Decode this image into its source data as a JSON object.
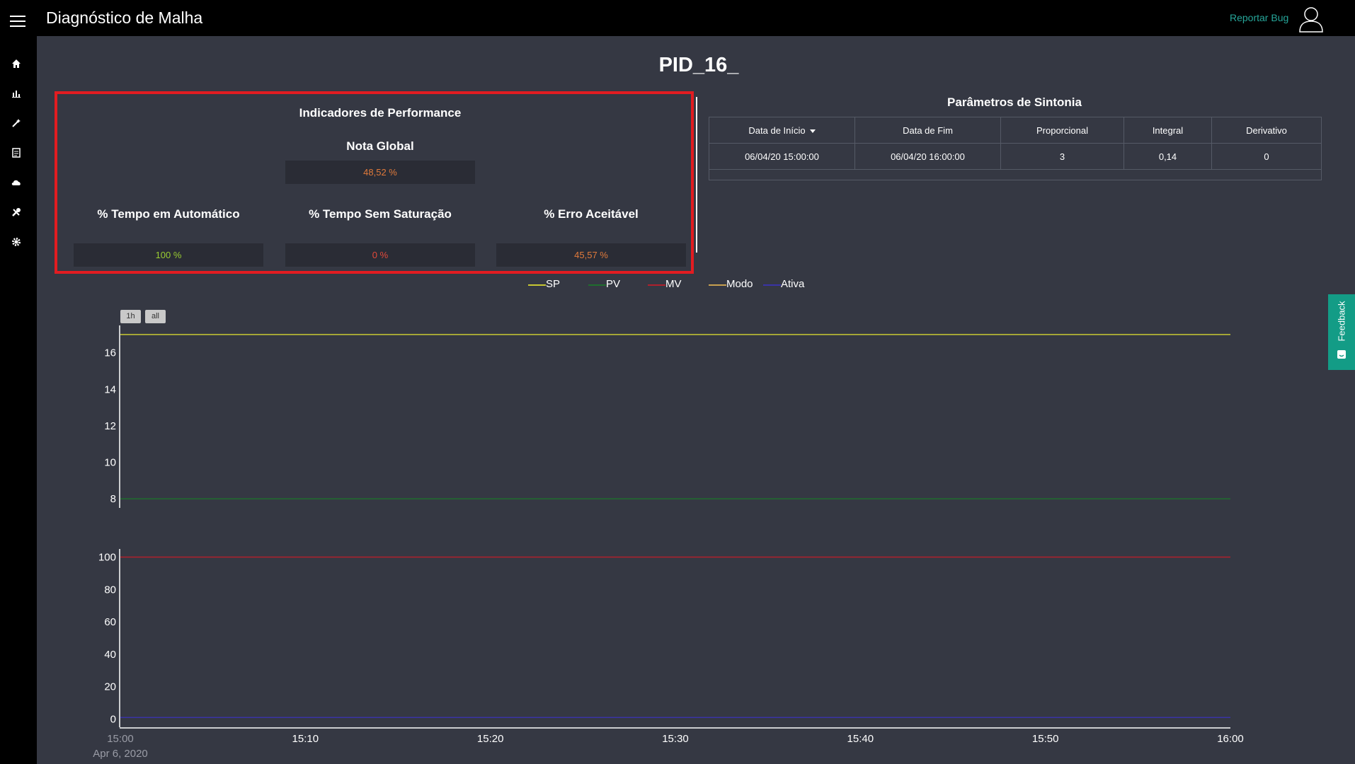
{
  "header": {
    "app_title": "Diagnóstico de Malha",
    "report_bug": "Reportar Bug"
  },
  "sidebar": {
    "items": [
      {
        "icon": "home-icon"
      },
      {
        "icon": "bar-chart-icon"
      },
      {
        "icon": "magic-wand-icon"
      },
      {
        "icon": "document-icon"
      },
      {
        "icon": "cloud-icon"
      },
      {
        "icon": "tools-icon"
      },
      {
        "icon": "gear-icon"
      }
    ]
  },
  "page": {
    "title": "PID_16_"
  },
  "performance": {
    "title": "Indicadores de Performance",
    "global": {
      "label": "Nota Global",
      "value": "48,52 %",
      "color": "#e07a3b"
    },
    "indicators": [
      {
        "label": "% Tempo em Automático",
        "value": "100 %",
        "color": "#9acd32"
      },
      {
        "label": "% Tempo Sem Saturação",
        "value": "0 %",
        "color": "#e4493a"
      },
      {
        "label": "% Erro Aceitável",
        "value": "45,57 %",
        "color": "#e07a3b"
      }
    ]
  },
  "tuning": {
    "title": "Parâmetros de Sintonia",
    "columns": [
      "Data de Início",
      "Data de Fim",
      "Proporcional",
      "Integral",
      "Derivativo"
    ],
    "rows": [
      [
        "06/04/20 15:00:00",
        "06/04/20 16:00:00",
        "3",
        "0,14",
        "0"
      ]
    ]
  },
  "range_buttons": [
    "1h",
    "all"
  ],
  "feedback": {
    "label": "Feedback"
  },
  "colors": {
    "accent": "#26a69a",
    "highlight_border": "#e21c21",
    "background": "#353843",
    "feedback": "#139c86"
  },
  "chart_data": {
    "type": "line",
    "legend": [
      {
        "name": "SP",
        "color": "#c8c832"
      },
      {
        "name": "PV",
        "color": "#1f6e2e"
      },
      {
        "name": "MV",
        "color": "#b0202c"
      },
      {
        "name": "Modo",
        "color": "#c8a050"
      },
      {
        "name": "Ativa",
        "color": "#3a33a6"
      }
    ],
    "x_ticks": [
      "15:00",
      "15:10",
      "15:20",
      "15:30",
      "15:40",
      "15:50",
      "16:00"
    ],
    "x_sublabel": "Apr 6, 2020",
    "top_panel": {
      "ylim": [
        7.5,
        17.5
      ],
      "y_ticks": [
        8,
        10,
        12,
        14,
        16
      ],
      "series": [
        {
          "name": "SP",
          "values": [
            17,
            17,
            17,
            17,
            17,
            17,
            17
          ]
        },
        {
          "name": "PV",
          "values": [
            8,
            8,
            8,
            8,
            8,
            8,
            8
          ]
        }
      ]
    },
    "bottom_panel": {
      "ylim": [
        -5,
        105
      ],
      "y_ticks": [
        0,
        20,
        40,
        60,
        80,
        100
      ],
      "series": [
        {
          "name": "MV",
          "values": [
            100,
            100,
            100,
            100,
            100,
            100,
            100
          ]
        },
        {
          "name": "Modo",
          "values": [
            1,
            1,
            1,
            1,
            1,
            1,
            1
          ]
        },
        {
          "name": "Ativa",
          "values": [
            1,
            1,
            1,
            1,
            1,
            1,
            1
          ]
        }
      ]
    }
  }
}
